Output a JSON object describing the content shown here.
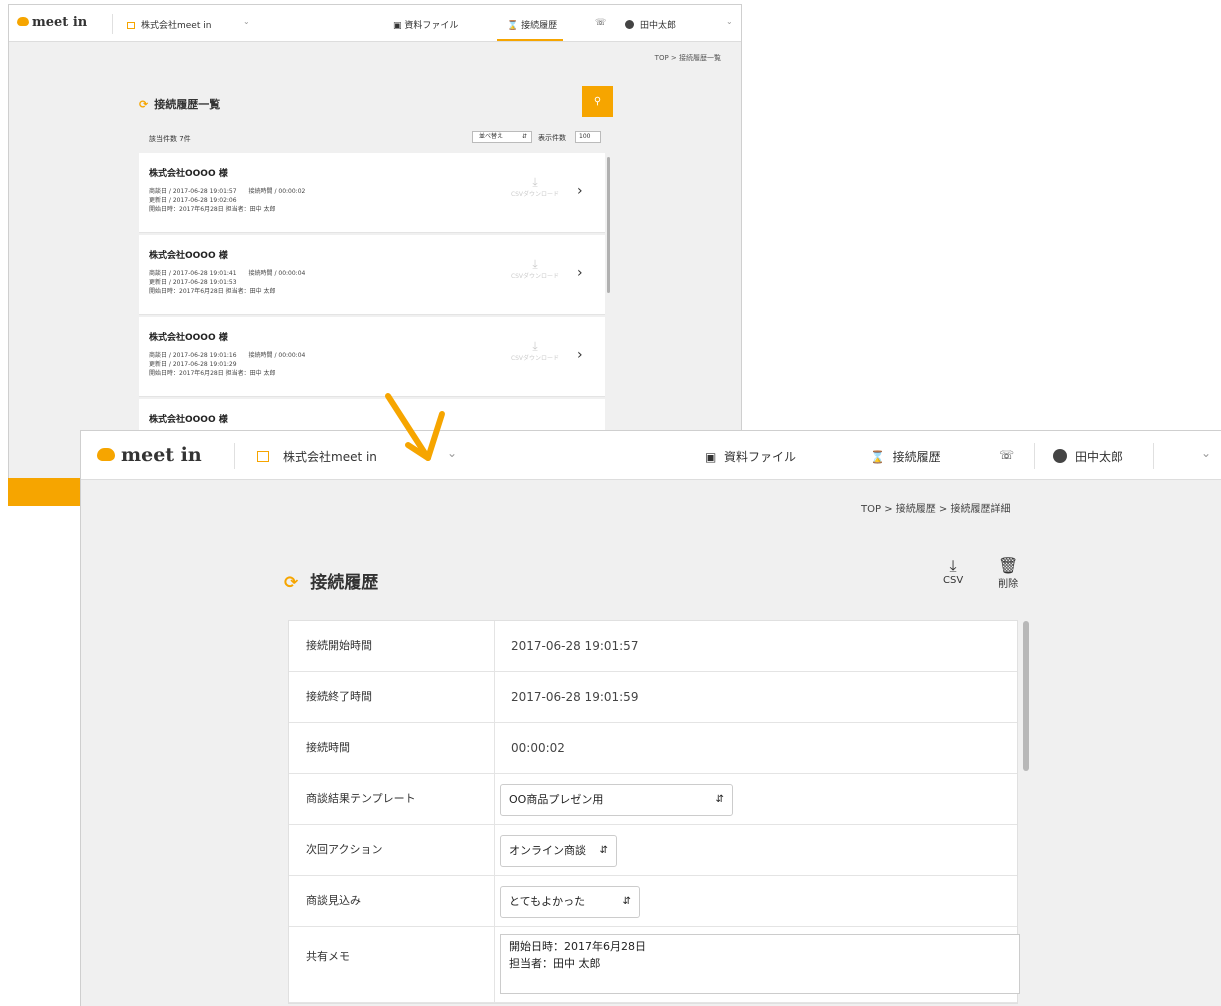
{
  "app": {
    "logo_text": "meet in",
    "company": "株式会社meet in",
    "nav": {
      "files": "資料ファイル",
      "history": "接続履歴",
      "user": "田中太郎"
    }
  },
  "list_window": {
    "breadcrumb": "TOP > 接続履歴一覧",
    "title": "接続履歴一覧",
    "count": "該当件数 7件",
    "sort_select": "並べ替え",
    "display_count_label": "表示件数",
    "display_count_value": "100",
    "items": [
      {
        "company": "株式会社OOOO 様",
        "line1": "商談日 / 2017-06-28 19:01:57　　接続時間 / 00:00:02",
        "line2": "更新日 / 2017-06-28 19:02:06",
        "line3": "開始日時：2017年6月28日 担当者：田中 太郎",
        "download": "CSVダウンロード"
      },
      {
        "company": "株式会社OOOO 様",
        "line1": "商談日 / 2017-06-28 19:01:41　　接続時間 / 00:00:04",
        "line2": "更新日 / 2017-06-28 19:01:53",
        "line3": "開始日時：2017年6月28日 担当者：田中 太郎",
        "download": "CSVダウンロード"
      },
      {
        "company": "株式会社OOOO 様",
        "line1": "商談日 / 2017-06-28 19:01:16　　接続時間 / 00:00:04",
        "line2": "更新日 / 2017-06-28 19:01:29",
        "line3": "開始日時：2017年6月28日 担当者：田中 太郎",
        "download": "CSVダウンロード"
      },
      {
        "company": "株式会社OOOO 様"
      }
    ]
  },
  "detail_window": {
    "breadcrumb": "TOP > 接続履歴 > 接続履歴詳細",
    "title": "接続履歴",
    "actions": {
      "csv": "CSV",
      "delete": "削除"
    },
    "rows": [
      {
        "label": "接続開始時間",
        "value": "2017-06-28 19:01:57"
      },
      {
        "label": "接続終了時間",
        "value": "2017-06-28 19:01:59"
      },
      {
        "label": "接続時間",
        "value": "00:00:02"
      },
      {
        "label": "商談結果テンプレート",
        "value": "OO商品プレゼン用"
      },
      {
        "label": "次回アクション",
        "value": "オンライン商談"
      },
      {
        "label": "商談見込み",
        "value": "とてもよかった"
      },
      {
        "label": "共有メモ",
        "value_line1": "開始日時：2017年6月28日",
        "value_line2": "担当者：田中 太郎"
      }
    ]
  },
  "colors": {
    "accent": "#f6a500",
    "background": "#f0f0f0"
  }
}
